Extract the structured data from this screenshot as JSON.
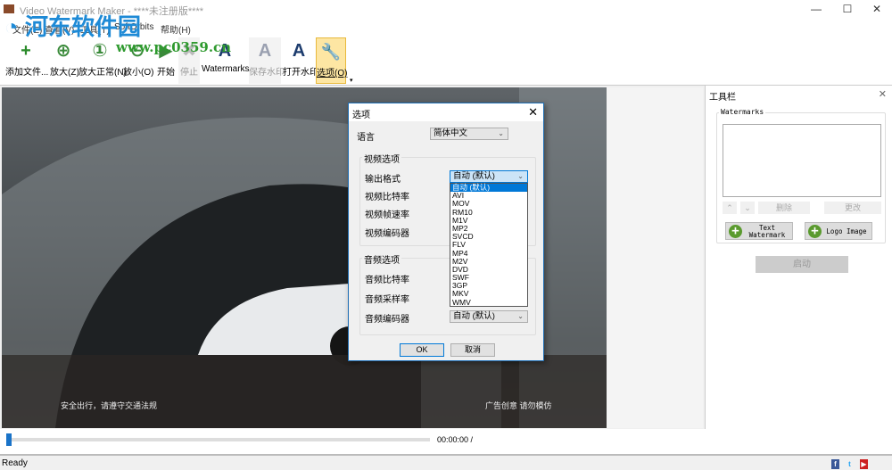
{
  "window": {
    "title": "Video Watermark Maker - ****未注册版****"
  },
  "menu": [
    "文件(E)",
    "查看(V)",
    "工具(T)",
    "SoftOrbits",
    "帮助(H)"
  ],
  "toolbar": [
    {
      "label": "添加文件...",
      "icon": "add-file-icon",
      "glyph": "+"
    },
    {
      "label": "放大(Z)",
      "icon": "zoom-in-icon",
      "glyph": "⊕"
    },
    {
      "label": "放大正常(N)",
      "icon": "zoom-normal-icon",
      "glyph": "①"
    },
    {
      "label": "放小(O)",
      "icon": "zoom-out-icon",
      "glyph": "⊖"
    },
    {
      "label": "开始",
      "icon": "play-icon",
      "glyph": "▶"
    },
    {
      "label": "停止",
      "icon": "stop-icon",
      "glyph": "✖"
    },
    {
      "label": "Watermarks",
      "icon": "watermarks-icon",
      "glyph": "A"
    },
    {
      "label": "保存水印",
      "icon": "save-watermark-icon",
      "glyph": "A"
    },
    {
      "label": "打开水印",
      "icon": "open-watermark-icon",
      "glyph": "A"
    },
    {
      "label": "选项(O)",
      "icon": "wrench-icon",
      "glyph": "🔧"
    }
  ],
  "watermark_overlay": {
    "name": "河东软件园",
    "url": "www.pc0359.cn"
  },
  "video": {
    "caption_left": "安全出行，请遵守交通法规",
    "caption_right": "广告创意 请勿模仿"
  },
  "panel": {
    "title": "工具栏",
    "group": "Watermarks",
    "delete": "删除",
    "edit": "更改",
    "text_watermark": "Text Watermark",
    "logo_image": "Logo Image",
    "start": "启动"
  },
  "player": {
    "time": "00:00:00 /",
    "progress": 0
  },
  "status": {
    "text": "Ready"
  },
  "dialog": {
    "title": "选项",
    "language_label": "语言",
    "language_value": "简体中文",
    "video_group": "视频选项",
    "output_format": "输出格式",
    "output_format_value": "自动 (默认)",
    "video_bitrate": "视频比特率",
    "video_framerate": "视频帧速率",
    "video_codec": "视频编码器",
    "audio_group": "音频选项",
    "audio_bitrate": "音频比特率",
    "audio_samplerate": "音频采样率",
    "audio_codec": "音频编码器",
    "audio_codec_value": "自动 (默认)",
    "format_options": [
      "自动 (默认)",
      "AVI",
      "MOV",
      "RM10",
      "M1V",
      "MP2",
      "SVCD",
      "FLV",
      "MP4",
      "M2V",
      "DVD",
      "SWF",
      "3GP",
      "MKV",
      "WMV"
    ],
    "ok": "OK",
    "cancel": "取消"
  }
}
